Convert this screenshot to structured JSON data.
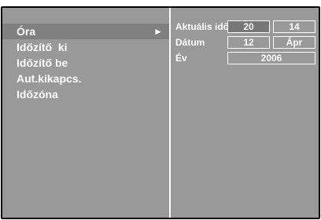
{
  "menu": {
    "items": [
      {
        "label": "Óra",
        "selected": true
      },
      {
        "label": "Időzítő  ki",
        "selected": false
      },
      {
        "label": "Időzítő be",
        "selected": false
      },
      {
        "label": "Aut.kikapcs.",
        "selected": false
      },
      {
        "label": "Időzóna",
        "selected": false
      }
    ],
    "selected_arrow": "►"
  },
  "clock": {
    "time_label": "Aktuális idő",
    "hour": "20",
    "minute": "14",
    "date_label": "Dátum",
    "day": "12",
    "month": "Ápr",
    "year_label": "Év",
    "year": "2006"
  },
  "colors": {
    "panel": "#999999",
    "selection": "#808080",
    "frame": "#000000",
    "text": "#ffffff"
  }
}
